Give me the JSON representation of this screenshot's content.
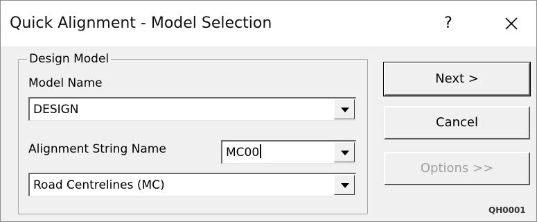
{
  "window": {
    "title": "Quick Alignment - Model Selection",
    "help_label": "?",
    "close_label": "close"
  },
  "group": {
    "legend": "Design Model",
    "model_name_label": "Model Name",
    "model_name_value": "DESIGN",
    "alignment_string_label": "Alignment String Name",
    "alignment_string_value": "MC00",
    "string_type_value": "Road Centrelines (MC)"
  },
  "buttons": {
    "next": "Next >",
    "cancel": "Cancel",
    "options": "Options >>"
  },
  "form_code": "QH0001"
}
